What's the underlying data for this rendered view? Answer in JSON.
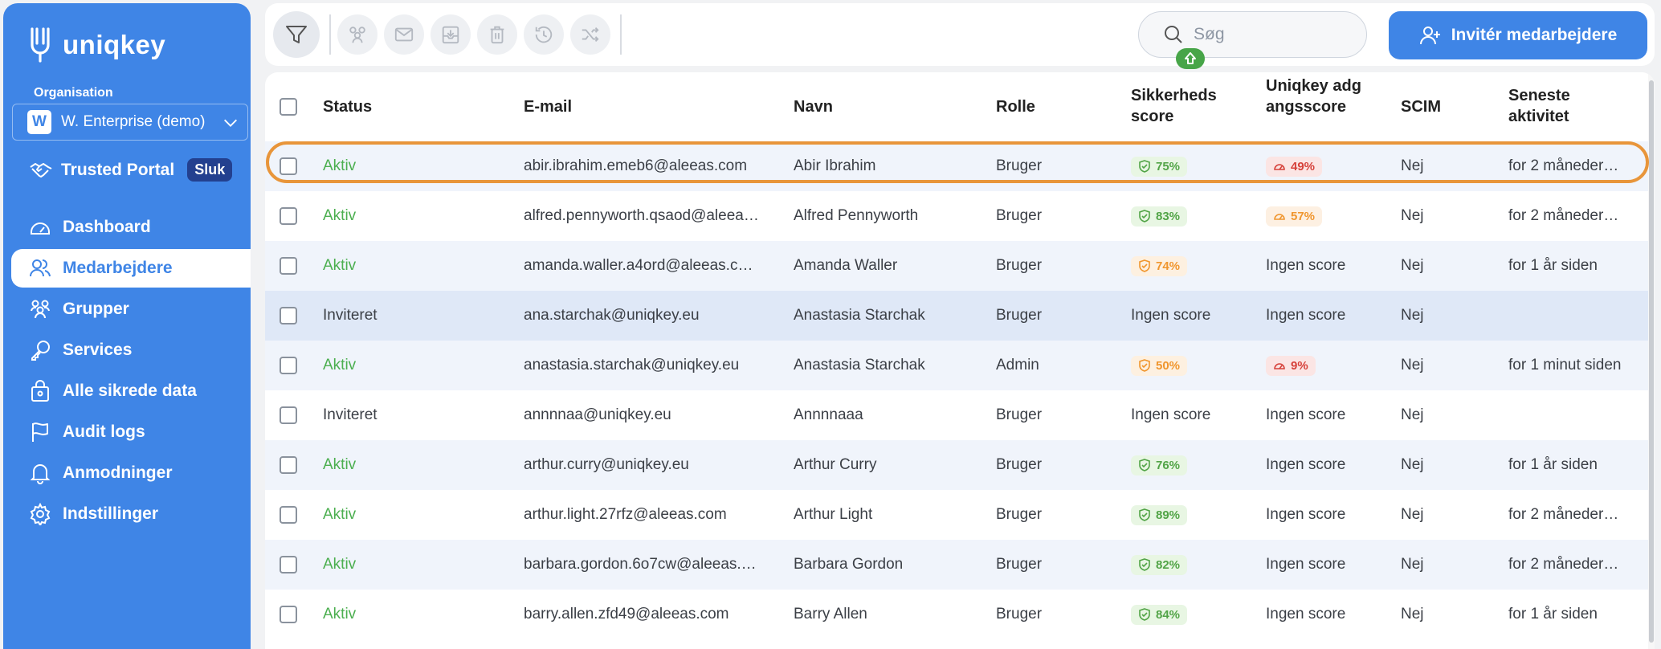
{
  "app": {
    "logo_text": "uniqkey"
  },
  "sidebar": {
    "org_label": "Organisation",
    "org_initial": "W",
    "org_name": "W. Enterprise (demo)",
    "trusted_portal": "Trusted Portal",
    "trusted_toggle": "Sluk",
    "items": [
      {
        "label": "Dashboard",
        "icon": "dashboard-icon"
      },
      {
        "label": "Medarbejdere",
        "icon": "users-icon",
        "active": true
      },
      {
        "label": "Grupper",
        "icon": "groups-icon"
      },
      {
        "label": "Services",
        "icon": "key-icon"
      },
      {
        "label": "Alle sikrede data",
        "icon": "lock-bag-icon"
      },
      {
        "label": "Audit logs",
        "icon": "flag-icon"
      },
      {
        "label": "Anmodninger",
        "icon": "bell-icon"
      },
      {
        "label": "Indstillinger",
        "icon": "gear-icon"
      }
    ]
  },
  "toolbar": {
    "search_placeholder": "Søg",
    "invite_label": "Invitér medarbejdere"
  },
  "table": {
    "headers": {
      "status": "Status",
      "email": "E-mail",
      "name": "Navn",
      "role": "Rolle",
      "security_score": "Sikkerheds score",
      "access_score": "Uniqkey adgangsscore",
      "scim": "SCIM",
      "activity": "Seneste aktivitet"
    },
    "rows": [
      {
        "status": "Aktiv",
        "email": "abir.ibrahim.emeb6@aleeas.com",
        "name": "Abir Ibrahim",
        "role": "Bruger",
        "sec": "75%",
        "sec_color": "green",
        "acc": "49%",
        "acc_color": "red",
        "scim": "Nej",
        "activity": "for 2 måneder…"
      },
      {
        "status": "Aktiv",
        "email": "alfred.pennyworth.qsaod@aleea…",
        "name": "Alfred Pennyworth",
        "role": "Bruger",
        "sec": "83%",
        "sec_color": "green",
        "acc": "57%",
        "acc_color": "orange",
        "scim": "Nej",
        "activity": "for 2 måneder…"
      },
      {
        "status": "Aktiv",
        "email": "amanda.waller.a4ord@aleeas.c…",
        "name": "Amanda Waller",
        "role": "Bruger",
        "sec": "74%",
        "sec_color": "amber",
        "acc": "Ingen score",
        "scim": "Nej",
        "activity": "for 1 år siden"
      },
      {
        "status": "Inviteret",
        "email": "ana.starchak@uniqkey.eu",
        "name": "Anastasia Starchak",
        "role": "Bruger",
        "sec": "Ingen score",
        "acc": "Ingen score",
        "scim": "Nej",
        "activity": ""
      },
      {
        "status": "Aktiv",
        "email": "anastasia.starchak@uniqkey.eu",
        "name": "Anastasia Starchak",
        "role": "Admin",
        "sec": "50%",
        "sec_color": "amber",
        "acc": "9%",
        "acc_color": "red",
        "scim": "Nej",
        "activity": "for 1 minut siden"
      },
      {
        "status": "Inviteret",
        "email": "annnnaa@uniqkey.eu",
        "name": "Annnnaaa",
        "role": "Bruger",
        "sec": "Ingen score",
        "acc": "Ingen score",
        "scim": "Nej",
        "activity": ""
      },
      {
        "status": "Aktiv",
        "email": "arthur.curry@uniqkey.eu",
        "name": "Arthur Curry",
        "role": "Bruger",
        "sec": "76%",
        "sec_color": "green",
        "acc": "Ingen score",
        "scim": "Nej",
        "activity": "for 1 år siden"
      },
      {
        "status": "Aktiv",
        "email": "arthur.light.27rfz@aleeas.com",
        "name": "Arthur Light",
        "role": "Bruger",
        "sec": "89%",
        "sec_color": "green",
        "acc": "Ingen score",
        "scim": "Nej",
        "activity": "for 2 måneder…"
      },
      {
        "status": "Aktiv",
        "email": "barbara.gordon.6o7cw@aleeas.…",
        "name": "Barbara Gordon",
        "role": "Bruger",
        "sec": "82%",
        "sec_color": "green",
        "acc": "Ingen score",
        "scim": "Nej",
        "activity": "for 2 måneder…"
      },
      {
        "status": "Aktiv",
        "email": "barry.allen.zfd49@aleeas.com",
        "name": "Barry Allen",
        "role": "Bruger",
        "sec": "84%",
        "sec_color": "green",
        "acc": "Ingen score",
        "scim": "Nej",
        "activity": "for 1 år siden"
      }
    ]
  }
}
